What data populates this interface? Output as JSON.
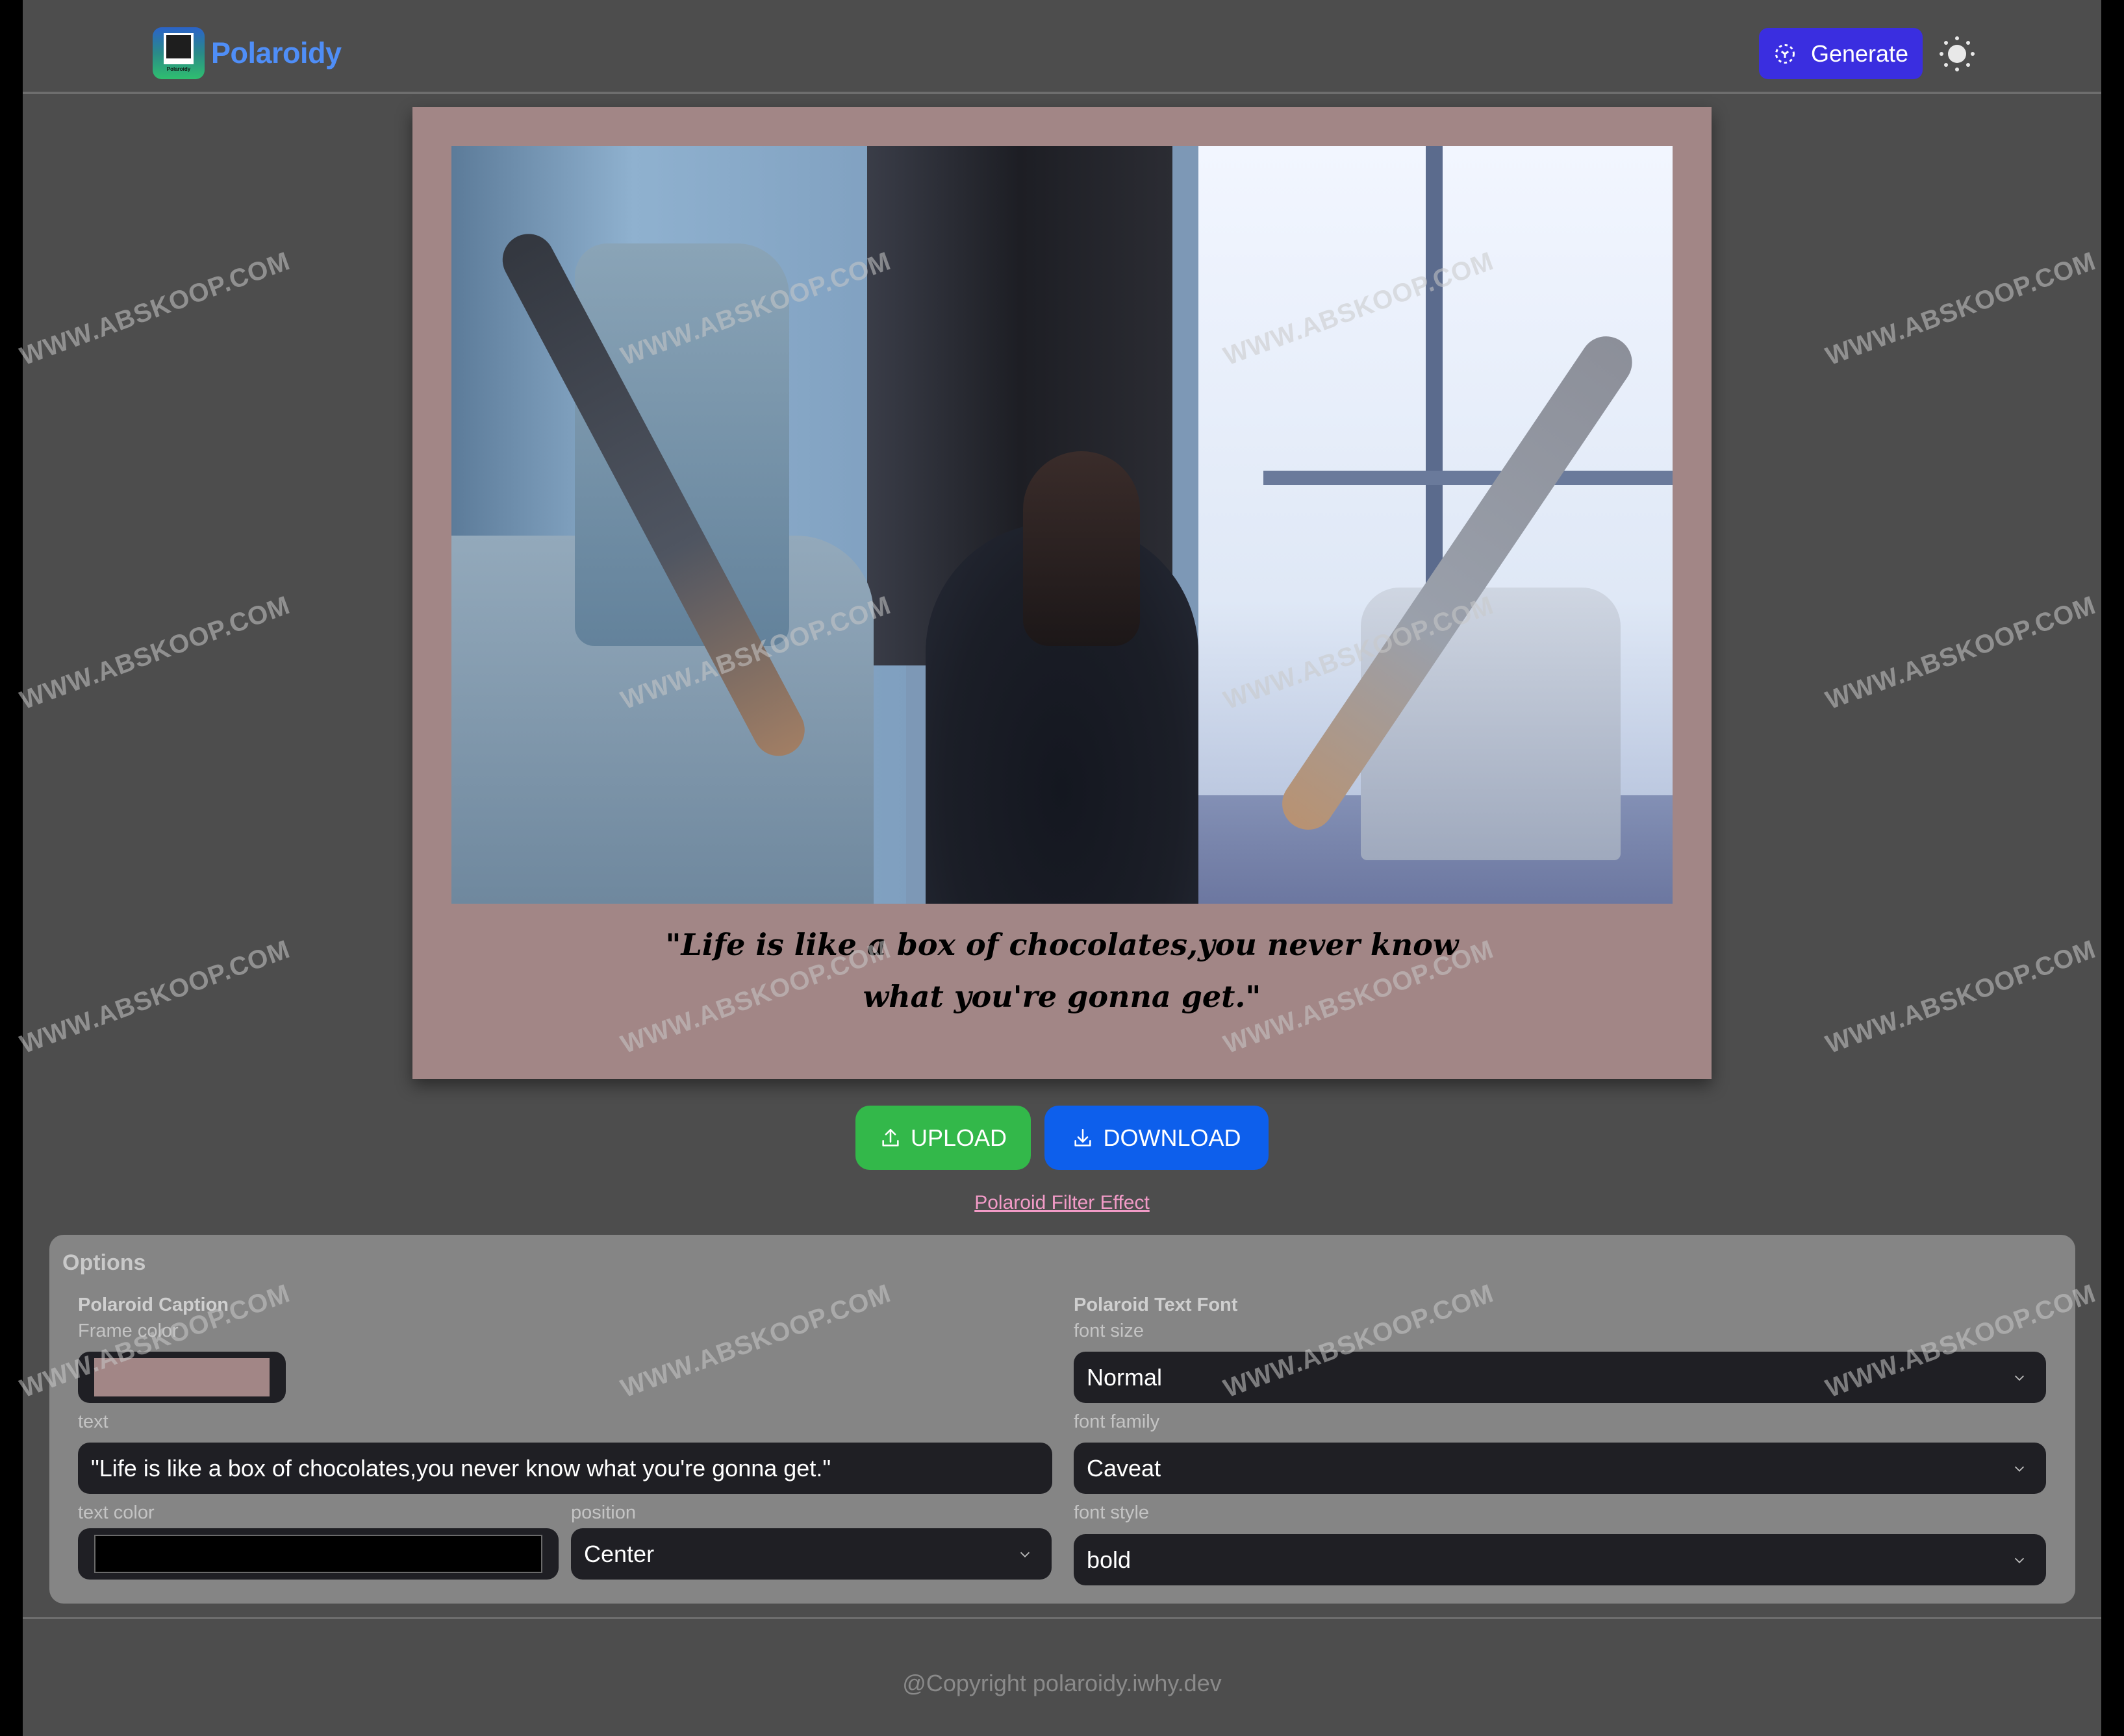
{
  "header": {
    "app_name": "Polaroidy",
    "logo_mini_text": "Polaroidy",
    "generate_label": "Generate",
    "theme_icon": "sun-icon"
  },
  "polaroid": {
    "frame_color": "#a28686",
    "caption_line1": "\"Life is like a box of chocolates,you never know",
    "caption_line2": "what you're gonna get.\"",
    "caption_color": "#000000"
  },
  "actions": {
    "upload_label": "UPLOAD",
    "download_label": "DOWNLOAD",
    "filter_link": "Polaroid Filter Effect",
    "upload_color": "#33b84a",
    "download_color": "#0d5fec"
  },
  "options": {
    "title": "Options",
    "caption_section": {
      "title": "Polaroid Caption",
      "frame_color_label": "Frame color",
      "frame_color_value": "#a28686",
      "text_label": "text",
      "text_value": "\"Life is like a box of chocolates,you never know what you're gonna get.\"",
      "text_color_label": "text color",
      "text_color_value": "#000000",
      "position_label": "position",
      "position_value": "Center"
    },
    "font_section": {
      "title": "Polaroid Text Font",
      "font_size_label": "font size",
      "font_size_value": "Normal",
      "font_family_label": "font family",
      "font_family_value": "Caveat",
      "font_style_label": "font style",
      "font_style_value": "bold"
    }
  },
  "footer": {
    "copyright": "@Copyright polaroidy.iwhy.dev"
  },
  "watermark": "WWW.ABSKOOP.COM"
}
